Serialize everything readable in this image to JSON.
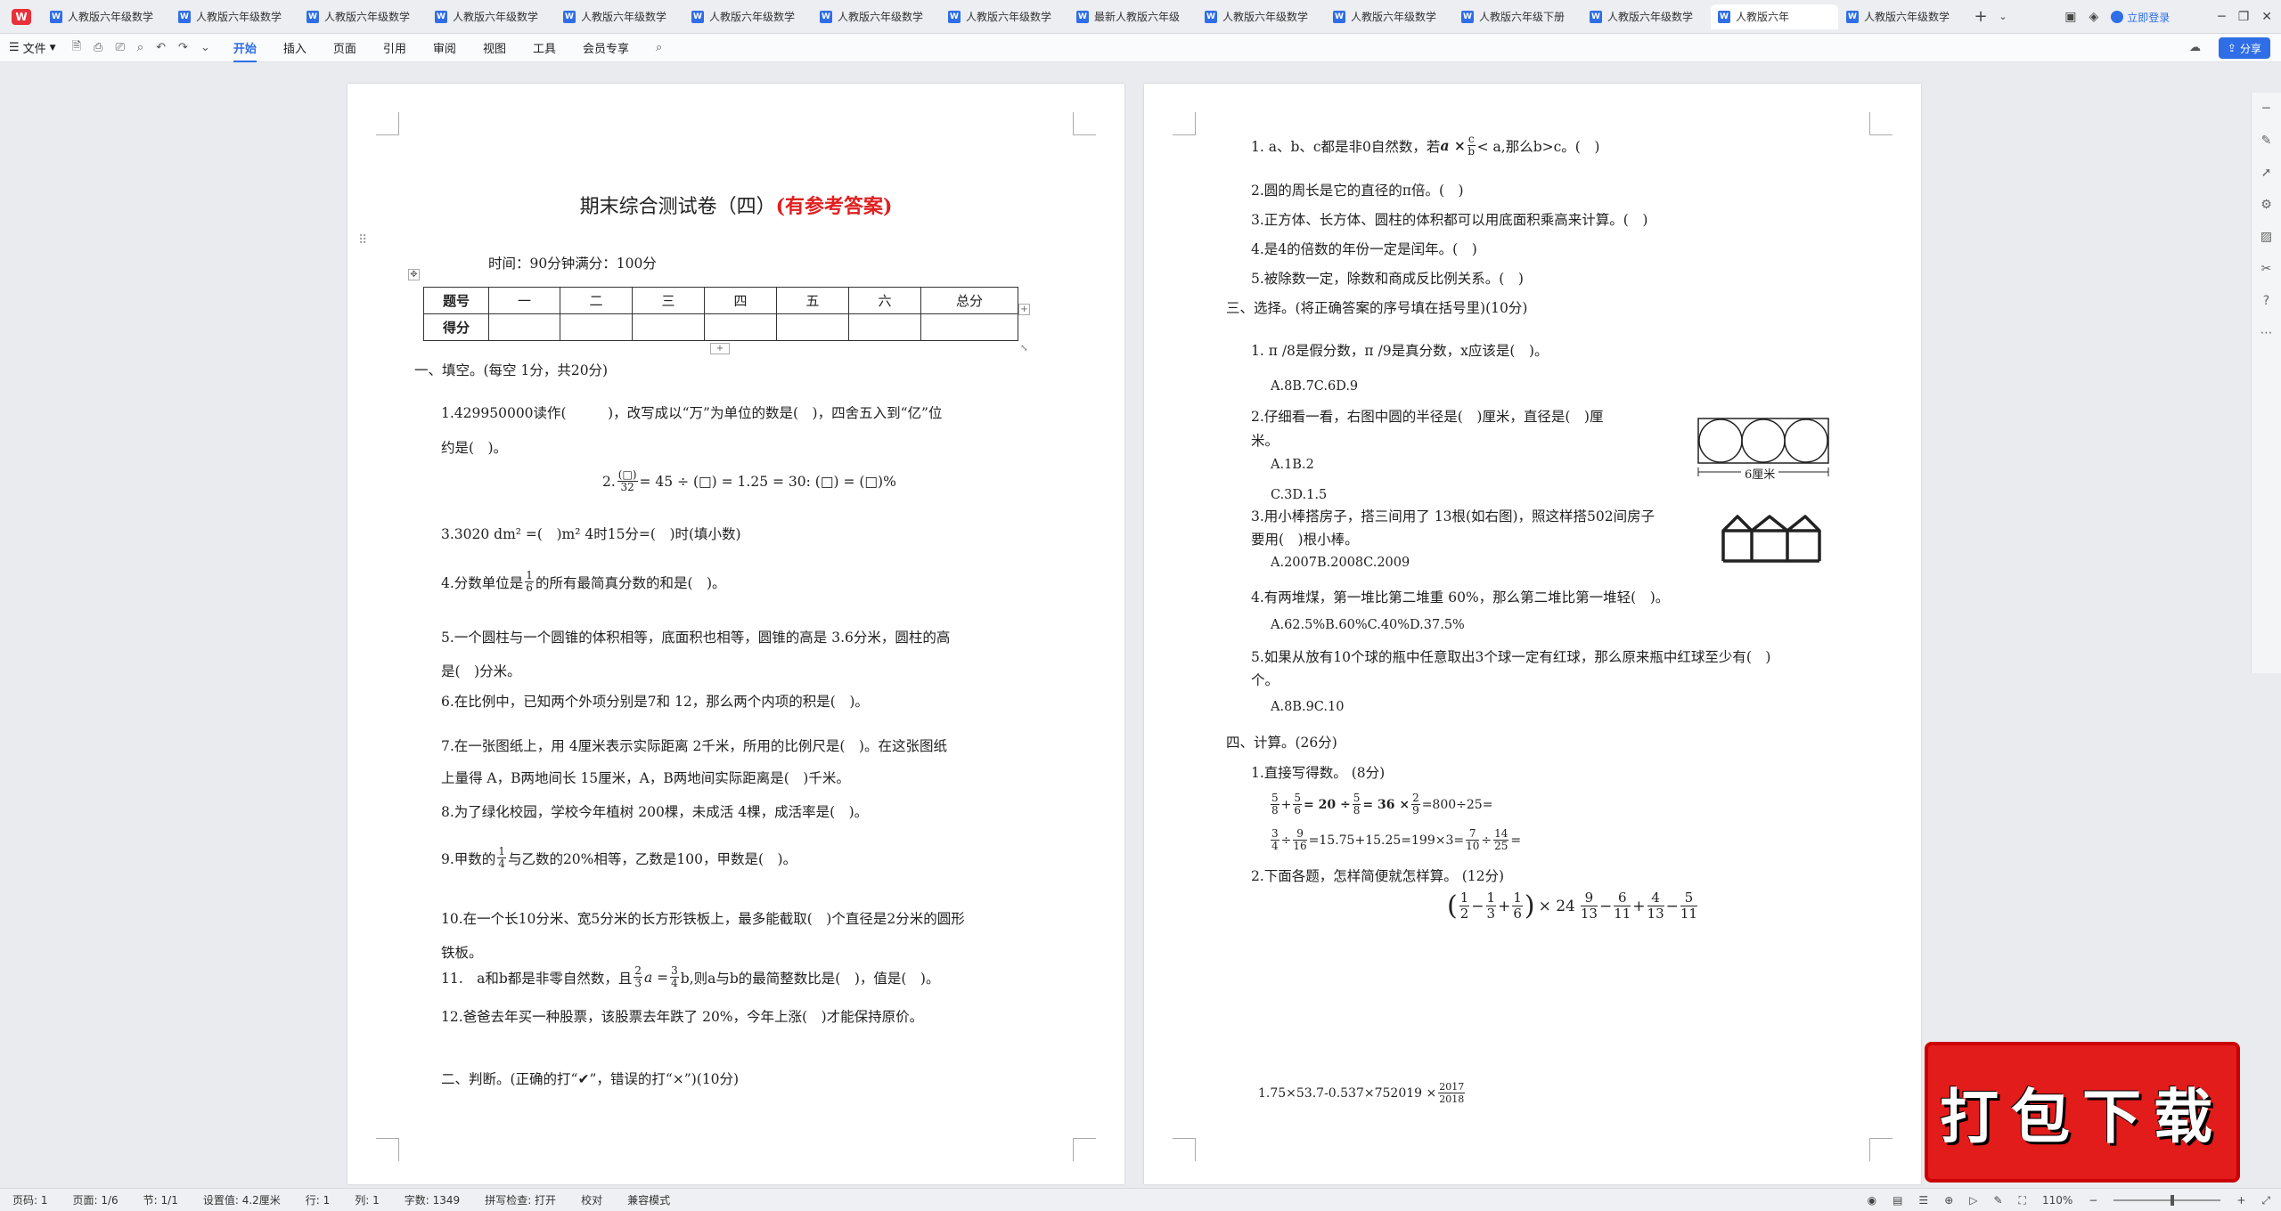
{
  "app": {
    "logo": "W"
  },
  "tabs": [
    {
      "label": "人教版六年级数学",
      "active": false
    },
    {
      "label": "人教版六年级数学",
      "active": false
    },
    {
      "label": "人教版六年级数学",
      "active": false
    },
    {
      "label": "人教版六年级数学",
      "active": false
    },
    {
      "label": "人教版六年级数学",
      "active": false
    },
    {
      "label": "人教版六年级数学",
      "active": false
    },
    {
      "label": "人教版六年级数学",
      "active": false
    },
    {
      "label": "人教版六年级数学",
      "active": false
    },
    {
      "label": "最新人教版六年级",
      "active": false
    },
    {
      "label": "人教版六年级数学",
      "active": false
    },
    {
      "label": "人教版六年级数学",
      "active": false
    },
    {
      "label": "人教版六年级下册",
      "active": false
    },
    {
      "label": "人教版六年级数学",
      "active": false
    },
    {
      "label": "人教版六年",
      "active": true
    },
    {
      "label": "人教版六年级数学",
      "active": false
    }
  ],
  "tabbar": {
    "login": "立即登录"
  },
  "menu": {
    "file": "文件",
    "items": [
      "开始",
      "插入",
      "页面",
      "引用",
      "审阅",
      "视图",
      "工具",
      "会员专享"
    ],
    "share": "分享"
  },
  "page1": {
    "title": "期末综合测试卷（四）",
    "title_note": "(有参考答案)",
    "time": "时间：90分钟满分：100分",
    "table": {
      "headers": [
        "题号",
        "一",
        "二",
        "三",
        "四",
        "五",
        "六",
        "总分"
      ],
      "row_label": "得分"
    },
    "sec1": "一、填空。(每空 1分，共20分)",
    "q1a": "1.429950000读作(　　　)，改写成以“万”为单位的数是(　)，四舍五入到“亿”位",
    "q1b": "约是(　)。",
    "q2": "2.",
    "q2_num": "(□)",
    "q2_den": "32",
    "q2_rest": "= 45 ÷ (□) = 1.25 = 30: (□) = (□)%",
    "q3": "3.3020 dm² =(　)m² 4时15分=(　)时(填小数)",
    "q4a": "4.分数单位是",
    "q4_n": "1",
    "q4_d": "6",
    "q4b": "的所有最简真分数的和是(　)。",
    "q5a": "5.一个圆柱与一个圆锥的体积相等，底面积也相等，圆锥的高是 3.6分米，圆柱的高",
    "q5b": "是(　)分米。",
    "q6": "6.在比例中，已知两个外项分别是7和 12，那么两个内项的积是(　)。",
    "q7a": "7.在一张图纸上，用 4厘米表示实际距离 2千米，所用的比例尺是(　)。在这张图纸",
    "q7b": "上量得 A，B两地间长 15厘米，A，B两地间实际距离是(　)千米。",
    "q8": "8.为了绿化校园，学校今年植树 200棵，未成活 4棵，成活率是(　)。",
    "q9a": "9.甲数的",
    "q9_n": "1",
    "q9_d": "4",
    "q9b": "与乙数的20%相等，乙数是100，甲数是(　)。",
    "q10a": "10.在一个长10分米、宽5分米的长方形铁板上，最多能截取(　)个直径是2分米的圆形",
    "q10b": "铁板。",
    "q11a": "11.　a和b都是非零自然数，且",
    "q11_n1": "2",
    "q11_d1": "3",
    "q11_mid": "a =",
    "q11_n2": "3",
    "q11_d2": "4",
    "q11b": "b,则a与b的最简整数比是(　)，值是(　)。",
    "q12": "12.爸爸去年买一种股票，该股票去年跌了 20%，今年上涨(　)才能保持原价。",
    "sec2": "二、判断。(正确的打“✔”，错误的打“×”)(10分)"
  },
  "page2": {
    "j1a": "1. a、b、c都是非0自然数，若",
    "j1_expr": "a ×",
    "j1_n": "c",
    "j1_d": "b",
    "j1b": "< a,那么b>c。(　)",
    "j2": "2.圆的周长是它的直径的π倍。(　)",
    "j3": "3.正方体、长方体、圆柱的体积都可以用底面积乘高来计算。(　)",
    "j4": "4.是4的倍数的年份一定是闰年。(　)",
    "j5": "5.被除数一定，除数和商成反比例关系。(　)",
    "sec3": "三、选择。(将正确答案的序号填在括号里)(10分)",
    "c1": "1. π /8是假分数，π /9是真分数，x应该是(　)。",
    "c1_opts": "A.8B.7C.6D.9",
    "c2a": "2.仔细看一看，右图中圆的半径是(　)厘米，直径是(　)厘",
    "c2b": "米。",
    "c2_opts1": "A.1B.2",
    "c2_opts2": "C.3D.1.5",
    "c2_fig_label": "6厘米",
    "c3a": "3.用小棒搭房子，搭三间用了 13根(如右图)，照这样搭502间房子",
    "c3b": "要用(　)根小棒。",
    "c3_opts": "A.2007B.2008C.2009",
    "c4": "4.有两堆煤，第一堆比第二堆重 60%，那么第二堆比第一堆轻(　)。",
    "c4_opts": "A.62.5%B.60%C.40%D.37.5%",
    "c5a": "5.如果从放有10个球的瓶中任意取出3个球一定有红球，那么原来瓶中红球至少有(　)",
    "c5b": "个。",
    "c5_opts": "A.8B.9C.10",
    "sec4": "四、计算。(26分)",
    "k1": "1.直接写得数。 (8分)",
    "k1_line1": "= 20 ÷",
    "k1_line1b": "= 36 ×",
    "k1_line1c": "=800÷25=",
    "k1_line2": "=15.75+15.25=199×3=",
    "k1_line2b": "=",
    "k2": "2.下面各题，怎样简便就怎样算。 (12分)",
    "k2_expr": "× 24",
    "k3": "1.75×53.7-0.537×752019 ×",
    "k3_n": "2017",
    "k3_d": "2018"
  },
  "badge": {
    "text": "打包下载"
  },
  "status": {
    "page": "页码: 1",
    "pages": "页面: 1/6",
    "section": "节: 1/1",
    "setting": "设置值: 4.2厘米",
    "row": "行: 1",
    "col": "列: 1",
    "words": "字数: 1349",
    "spell": "拼写检查: 打开",
    "proof": "校对",
    "compat": "兼容模式",
    "zoom": "110%",
    "zoom_level": 0.55
  }
}
